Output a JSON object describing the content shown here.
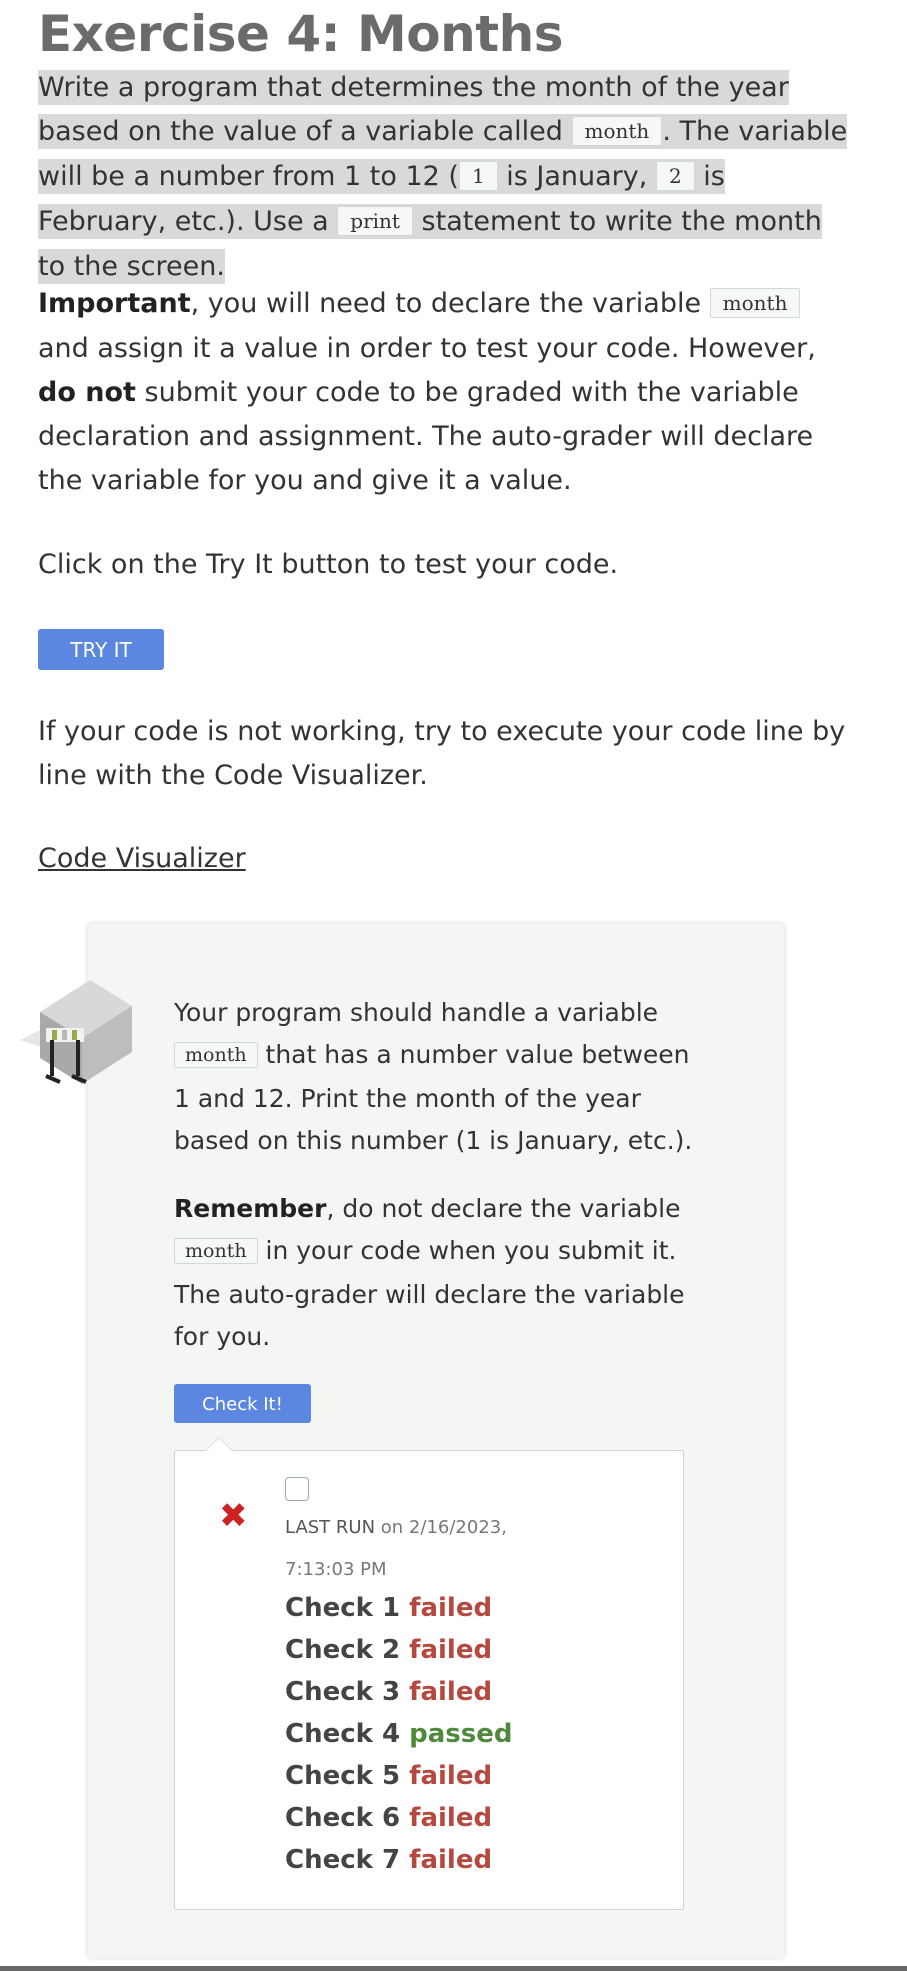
{
  "title": "Exercise 4: Months",
  "p1": {
    "a": "Write a program that determines the month of the year based on the value of a variable called ",
    "code1": "month",
    "b": ". The variable will be a number from 1 to 12 (",
    "code2": "1",
    "c": " is January, ",
    "code3": "2",
    "d": " is February, etc.). Use a ",
    "code4": "print",
    "e": " statement to write the month to the screen."
  },
  "p2": {
    "bold1": "Important",
    "a": ", you will need to declare the variable ",
    "code1": "month",
    "b": " and assign it a value in order to test your code. However, ",
    "bold2": "do not",
    "c": " submit your code to be graded with the variable declaration and assignment. The auto-grader will declare the variable for you and give it a value."
  },
  "p3": "Click on the Try It button to test your code.",
  "try_button": "TRY IT",
  "p4": "If your code is not working, try to execute your code line by line with the Code Visualizer.",
  "visualizer_link": "Code Visualizer",
  "panel": {
    "t1": {
      "a": "Your program should handle a variable ",
      "code1": "month",
      "b": " that has a number value between 1 and 12. Print the month of the year based on this number (1 is January, etc.)."
    },
    "t2": {
      "bold1": "Remember",
      "a": ", do not declare the variable ",
      "code1": "month",
      "b": " in your code when you submit it. The auto-grader will declare the variable for you."
    },
    "check_button": "Check It!",
    "result": {
      "last_run_label": "LAST RUN",
      "last_run_time": "on 2/16/2023, 7:13:03 PM",
      "checks": [
        {
          "label": "Check 1",
          "status": "failed"
        },
        {
          "label": "Check 2",
          "status": "failed"
        },
        {
          "label": "Check 3",
          "status": "failed"
        },
        {
          "label": "Check 4",
          "status": "passed"
        },
        {
          "label": "Check 5",
          "status": "failed"
        },
        {
          "label": "Check 6",
          "status": "failed"
        },
        {
          "label": "Check 7",
          "status": "failed"
        }
      ]
    }
  },
  "colors": {
    "button": "#5b87e0",
    "failed": "#b5483f",
    "passed": "#4f8a3c",
    "error_icon": "#cc2222"
  },
  "icons": {
    "result": "close-icon",
    "avatar": "hurdle-icon"
  }
}
